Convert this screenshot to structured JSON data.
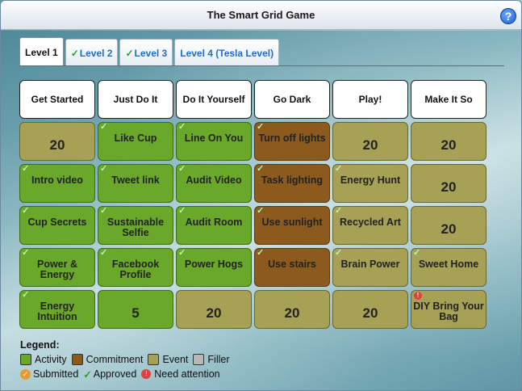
{
  "window": {
    "title": "The Smart Grid Game",
    "help_label": "?"
  },
  "tabs": [
    {
      "label": "Level 1",
      "approved": false
    },
    {
      "label": "Level 2",
      "approved": true
    },
    {
      "label": "Level 3",
      "approved": true
    },
    {
      "label": "Level 4 (Tesla Level)",
      "approved": false
    }
  ],
  "columns": [
    "Get Started",
    "Just Do It",
    "Do It Yourself",
    "Go Dark",
    "Play!",
    "Make It So"
  ],
  "rows": [
    [
      {
        "label": "20",
        "type": "event",
        "status": ""
      },
      {
        "label": "Like Cup",
        "type": "activity",
        "status": "approved"
      },
      {
        "label": "Line On You",
        "type": "activity",
        "status": "approved"
      },
      {
        "label": "Turn off lights",
        "type": "commitment",
        "status": "approved"
      },
      {
        "label": "20",
        "type": "event",
        "status": ""
      },
      {
        "label": "20",
        "type": "event",
        "status": ""
      }
    ],
    [
      {
        "label": "Intro video",
        "type": "activity",
        "status": "approved"
      },
      {
        "label": "Tweet link",
        "type": "activity",
        "status": "approved"
      },
      {
        "label": "Audit Video",
        "type": "activity",
        "status": "approved"
      },
      {
        "label": "Task lighting",
        "type": "commitment",
        "status": "approved"
      },
      {
        "label": "Energy Hunt",
        "type": "event",
        "status": "approved"
      },
      {
        "label": "20",
        "type": "event",
        "status": ""
      }
    ],
    [
      {
        "label": "Cup Secrets",
        "type": "activity",
        "status": "approved"
      },
      {
        "label": "Sustainable Selfie",
        "type": "activity",
        "status": "approved"
      },
      {
        "label": "Audit Room",
        "type": "activity",
        "status": "approved"
      },
      {
        "label": "Use sunlight",
        "type": "commitment",
        "status": "approved"
      },
      {
        "label": "Recycled Art",
        "type": "event",
        "status": "approved"
      },
      {
        "label": "20",
        "type": "event",
        "status": ""
      }
    ],
    [
      {
        "label": "Power & Energy",
        "type": "activity",
        "status": "approved"
      },
      {
        "label": "Facebook Profile",
        "type": "activity",
        "status": "approved"
      },
      {
        "label": "Power Hogs",
        "type": "activity",
        "status": "approved"
      },
      {
        "label": "Use stairs",
        "type": "commitment",
        "status": "approved"
      },
      {
        "label": "Brain Power",
        "type": "event",
        "status": "approved"
      },
      {
        "label": "Sweet Home",
        "type": "event",
        "status": "approved"
      }
    ],
    [
      {
        "label": "Energy Intuition",
        "type": "activity",
        "status": "approved"
      },
      {
        "label": "5",
        "type": "activity",
        "status": ""
      },
      {
        "label": "20",
        "type": "event",
        "status": ""
      },
      {
        "label": "20",
        "type": "event",
        "status": ""
      },
      {
        "label": "20",
        "type": "event",
        "status": ""
      },
      {
        "label": "DIY Bring Your Bag",
        "type": "event",
        "status": "attention"
      }
    ]
  ],
  "legend": {
    "title": "Legend:",
    "types": [
      {
        "label": "Activity",
        "color": "#6aa82a"
      },
      {
        "label": "Commitment",
        "color": "#8c5a1c"
      },
      {
        "label": "Event",
        "color": "#a6a154"
      },
      {
        "label": "Filler",
        "color": "#b8b8b8"
      }
    ],
    "statuses": [
      {
        "label": "Submitted",
        "icon": "submitted-icon"
      },
      {
        "label": "Approved",
        "icon": "approved-check-icon"
      },
      {
        "label": "Need  attention",
        "icon": "attention-icon"
      }
    ]
  },
  "colors": {
    "activity": "#6aa82a",
    "commitment": "#8c5a1c",
    "event": "#a6a154",
    "filler": "#b8b8b8",
    "tab_link": "#1e6ec8"
  }
}
